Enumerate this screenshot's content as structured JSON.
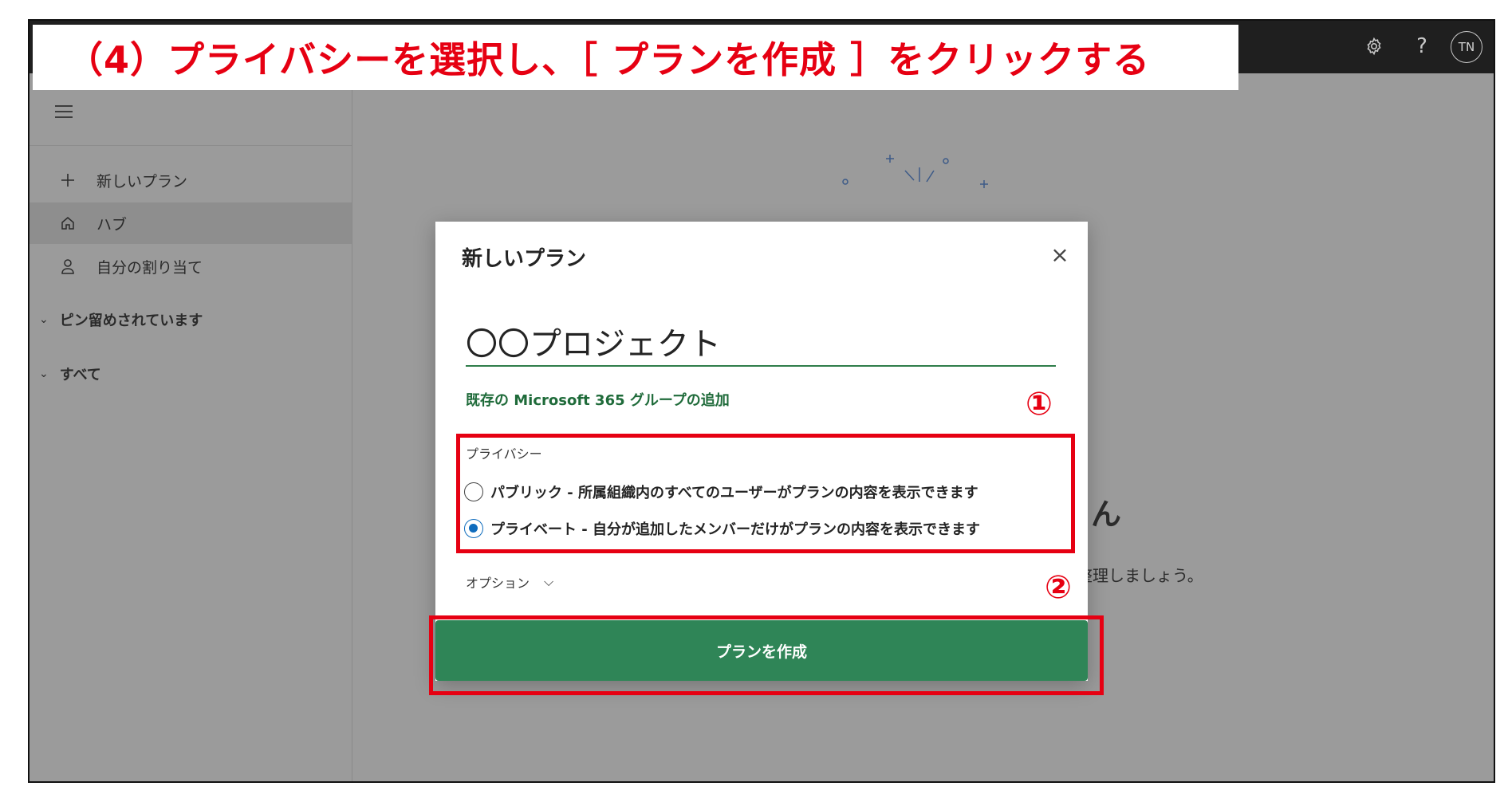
{
  "banner": {
    "text": "（4）プライバシーを選択し、［ プランを作成 ］をクリックする"
  },
  "topbar": {
    "avatar_initials": "TN",
    "help_label": "?"
  },
  "sidebar": {
    "items": [
      {
        "label": "新しいプラン",
        "icon": "plus-icon"
      },
      {
        "label": "ハブ",
        "icon": "home-icon"
      },
      {
        "label": "自分の割り当て",
        "icon": "person-icon"
      }
    ],
    "sections": [
      {
        "label": "ピン留めされています",
        "icon": "chevron-down-icon"
      },
      {
        "label": "すべて",
        "icon": "chevron-down-icon"
      }
    ]
  },
  "background": {
    "greeting_suffix": "さん",
    "subtitle_fragment": "を整理しましょう。"
  },
  "dialog": {
    "title": "新しいプラン",
    "plan_name_value": "〇〇プロジェクト",
    "group_link": "既存の Microsoft 365 グループの追加",
    "privacy_label": "プライバシー",
    "privacy_options": [
      {
        "label": "パブリック - 所属組織内のすべてのユーザーがプランの内容を表示できます",
        "checked": false
      },
      {
        "label": "プライベート - 自分が追加したメンバーだけがプランの内容を表示できます",
        "checked": true
      }
    ],
    "options_label": "オプション",
    "create_button": "プランを作成"
  },
  "annotations": {
    "step1": "①",
    "step2": "②"
  },
  "colors": {
    "accent_green": "#2f8557",
    "annotation_red": "#e60012",
    "radio_blue": "#0f6cbd"
  }
}
